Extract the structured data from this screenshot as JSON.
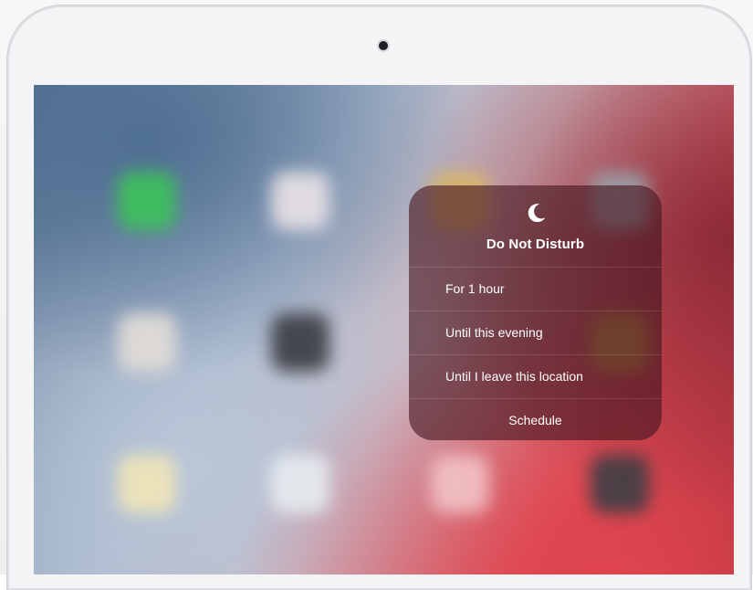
{
  "device": {
    "type": "iPad"
  },
  "home_screen": {
    "icons": [
      {
        "name": "facetime-app-icon",
        "color": "#3cc35a"
      },
      {
        "name": "calendar-app-icon",
        "color": "#e9e2e6"
      },
      {
        "name": "photos-app-icon",
        "color": "#d9b76a"
      },
      {
        "name": "camera-app-icon",
        "color": "#9aa0a8"
      },
      {
        "name": "contacts-app-icon",
        "color": "#e4ded8"
      },
      {
        "name": "clock-app-icon",
        "color": "#3a3c42"
      },
      {
        "name": "maps-app-icon",
        "color": "#b48a3c"
      },
      {
        "name": "notes-app-icon",
        "color": "#f1e6b8"
      },
      {
        "name": "reminders-app-icon",
        "color": "#e8eef2"
      },
      {
        "name": "news-app-icon",
        "color": "#f2c3c6"
      },
      {
        "name": "stocks-app-icon",
        "color": "#3d3f46"
      }
    ]
  },
  "dnd_menu": {
    "icon": "moon-icon",
    "title": "Do Not Disturb",
    "options": [
      {
        "label": "For 1 hour"
      },
      {
        "label": "Until this evening"
      },
      {
        "label": "Until I leave this location"
      }
    ],
    "schedule_label": "Schedule",
    "panel_color": "#461620"
  }
}
